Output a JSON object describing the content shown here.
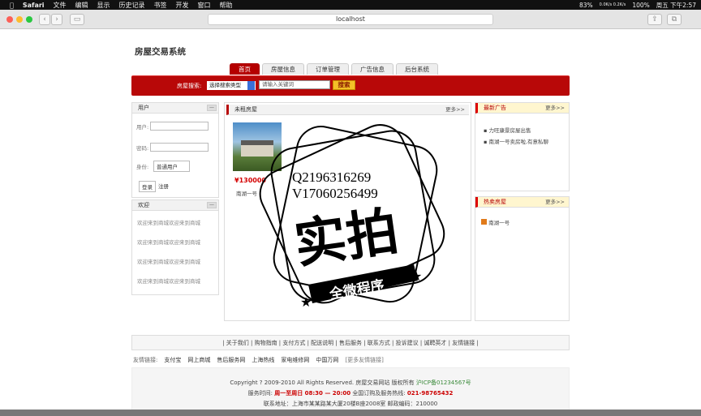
{
  "menubar": {
    "apple": "",
    "app": "Safari",
    "menus": [
      "文件",
      "编辑",
      "显示",
      "历史记录",
      "书签",
      "开发",
      "窗口",
      "帮助"
    ],
    "battery": "83%",
    "net": "0.0K/s 0.2K/s",
    "battery2": "100%",
    "date": "周五 下午2:57"
  },
  "browser": {
    "url": "localhost"
  },
  "site": {
    "title": "房屋交易系统",
    "tabs": [
      "首页",
      "房屋信息",
      "订单管理",
      "广告信息",
      "后台系统"
    ],
    "search_label": "房屋搜索:",
    "search_type": "选择搜索类型",
    "search_placeholder": "请输入关键词",
    "search_btn": "搜索"
  },
  "user": {
    "title": "用户",
    "user_label": "用户:",
    "pwd_label": "密码:",
    "role_label": "身份:",
    "role": "普通用户",
    "login": "登录",
    "register": "注册"
  },
  "welcome": {
    "title": "欢迎",
    "items": [
      "欢迎来到商城欢迎来到商城",
      "欢迎来到商城欢迎来到商城",
      "欢迎来到商城欢迎来到商城",
      "欢迎来到商城欢迎来到商城"
    ]
  },
  "rent": {
    "title": "未租房屋",
    "more": "更多>>",
    "price": "¥130000",
    "name": "南湖一号"
  },
  "ads": {
    "title": "最新广告",
    "more": "更多>>",
    "items": [
      "力旺康景房屋出售",
      "南湖一号卖房啦,有意私聊"
    ]
  },
  "hot": {
    "title": "热卖房屋",
    "more": "更多>>",
    "items": [
      "南湖一号"
    ]
  },
  "watermark": {
    "line1": "Q2196316269",
    "line2": "V17060256499",
    "big": "实拍",
    "banner": "全微程序"
  },
  "footer": {
    "nav": "| 关于我们 | 购物指南 | 支付方式 | 配送说明 | 售后服务 | 联系方式 | 投诉建议 | 诚聘英才 | 友情链接 |",
    "friend_label": "友情链接:",
    "friends": [
      "支付宝",
      "网上商城",
      "售后服务网",
      "上海热线",
      "家电维修网",
      "中国万网",
      "[更多友情链接]"
    ],
    "copyright": "Copyright ? 2009-2010 All Rights Reserved. 房屋交易网站 版权所有",
    "icp": "沪ICP备01234567号",
    "hours_label": "服务时间:",
    "hours": "周一至周日 08:30 — 20:00",
    "hotline_label": "全国订购及服务热线:",
    "hotline": "021-98765432",
    "addr": "联系地址：上海市某某路某大厦20楼B座2008室   邮政编码：210000"
  },
  "colors": {
    "brand_red": "#b80808",
    "search_yellow": "#f4c028"
  }
}
